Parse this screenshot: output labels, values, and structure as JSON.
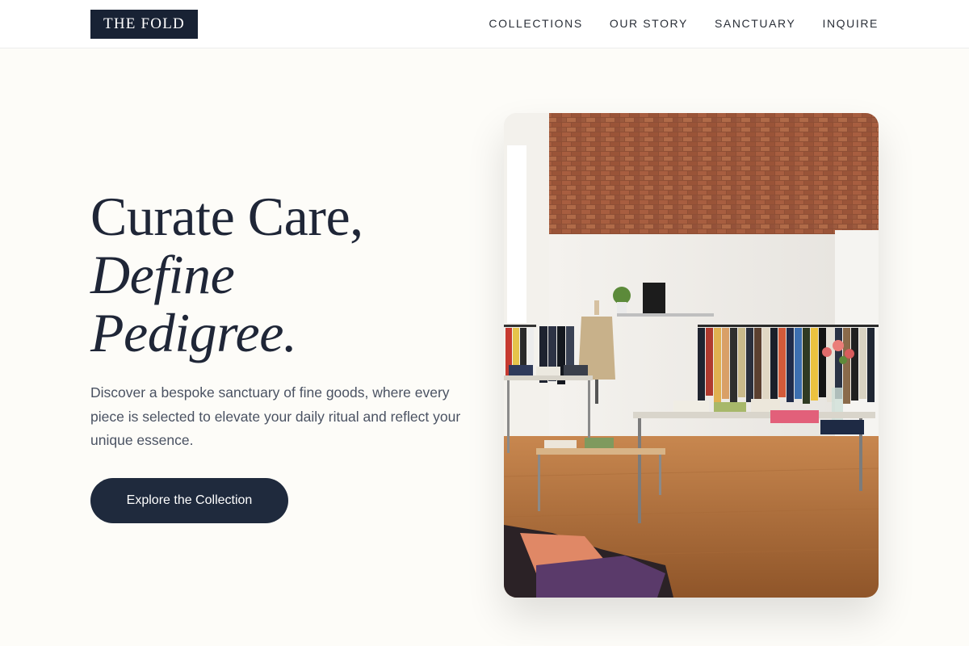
{
  "brand": {
    "name": "THE FOLD"
  },
  "nav": {
    "items": [
      {
        "label": "COLLECTIONS"
      },
      {
        "label": "OUR STORY"
      },
      {
        "label": "SANCTUARY"
      },
      {
        "label": "INQUIRE"
      }
    ]
  },
  "hero": {
    "title_line1": "Curate Care,",
    "title_line2": "Define",
    "title_line3": "Pedigree.",
    "description": "Discover a bespoke sanctuary of fine goods, where every piece is selected to elevate your daily ritual and reflect your unique essence.",
    "cta_label": "Explore the Collection"
  },
  "colors": {
    "page_background": "#fdfcf8",
    "brand_navy": "#182234",
    "cta_background": "#1f2a3d",
    "heading": "#1f2637",
    "body_text": "#4a5262"
  }
}
